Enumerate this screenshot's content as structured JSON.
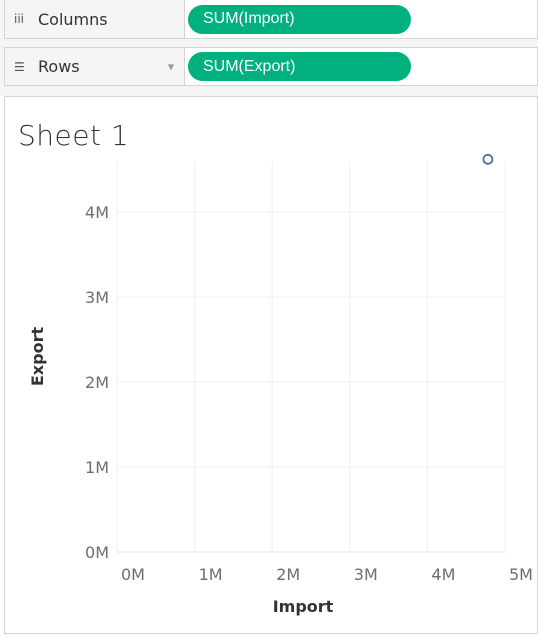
{
  "shelves": {
    "columns": {
      "label": "Columns",
      "icon": "iii",
      "pill": "SUM(Import)"
    },
    "rows": {
      "label": "Rows",
      "icon": "☰",
      "pill": "SUM(Export)"
    }
  },
  "sheet": {
    "title": "Sheet 1"
  },
  "chart_data": {
    "type": "scatter",
    "xlabel": "Import",
    "ylabel": "Export",
    "xlim": [
      0,
      5
    ],
    "ylim": [
      0,
      4.6
    ],
    "x_ticks": [
      {
        "value": 0,
        "label": "0M"
      },
      {
        "value": 1,
        "label": "1M"
      },
      {
        "value": 2,
        "label": "2M"
      },
      {
        "value": 3,
        "label": "3M"
      },
      {
        "value": 4,
        "label": "4M"
      },
      {
        "value": 5,
        "label": "5M"
      }
    ],
    "y_ticks": [
      {
        "value": 0,
        "label": "0M"
      },
      {
        "value": 1,
        "label": "1M"
      },
      {
        "value": 2,
        "label": "2M"
      },
      {
        "value": 3,
        "label": "3M"
      },
      {
        "value": 4,
        "label": "4M"
      }
    ],
    "points": [
      {
        "x": 4.78,
        "y": 4.62
      }
    ],
    "grid": true,
    "mark_color": "#4e6fa8"
  }
}
